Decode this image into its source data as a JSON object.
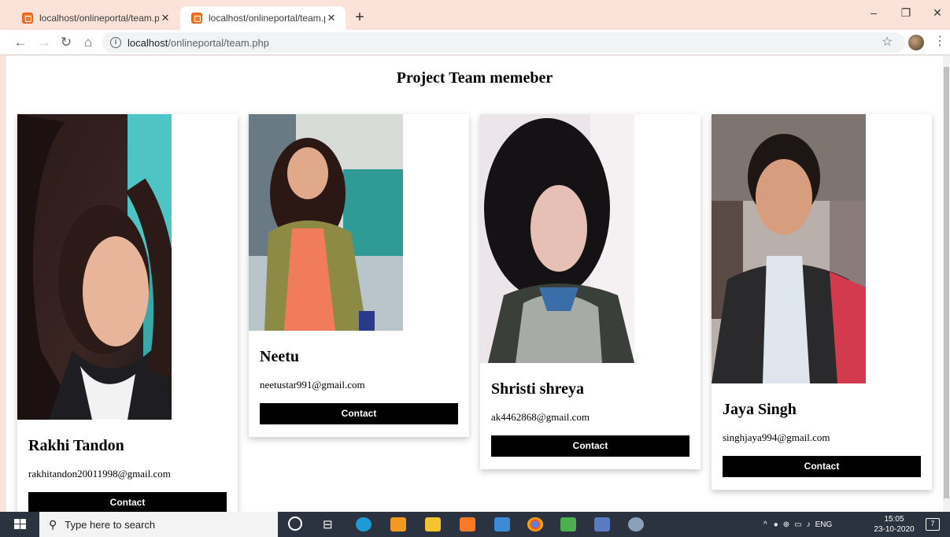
{
  "browser": {
    "tabs": [
      {
        "title": "localhost/onlineportal/team.php"
      },
      {
        "title": "localhost/onlineportal/team.php"
      }
    ],
    "address": {
      "host": "localhost",
      "path": "/onlineportal/team.php"
    }
  },
  "page": {
    "title": "Project Team memeber",
    "members": [
      {
        "name": "Rakhi Tandon",
        "email": "rakhitandon20011998@gmail.com",
        "contact_label": "Contact"
      },
      {
        "name": "Neetu",
        "email": "neetustar991@gmail.com",
        "contact_label": "Contact"
      },
      {
        "name": "Shristi shreya",
        "email": "ak4462868@gmail.com",
        "contact_label": "Contact"
      },
      {
        "name": "Jaya Singh",
        "email": "singhjaya994@gmail.com",
        "contact_label": "Contact"
      }
    ]
  },
  "taskbar": {
    "search_placeholder": "Type here to search",
    "language": "ENG",
    "time": "15:05",
    "date": "23-10-2020",
    "notification_count": "7"
  },
  "colors": {
    "button_bg": "#000000",
    "taskbar_bg": "#2b3341",
    "tabstrip_bg": "#fbe3d9"
  }
}
